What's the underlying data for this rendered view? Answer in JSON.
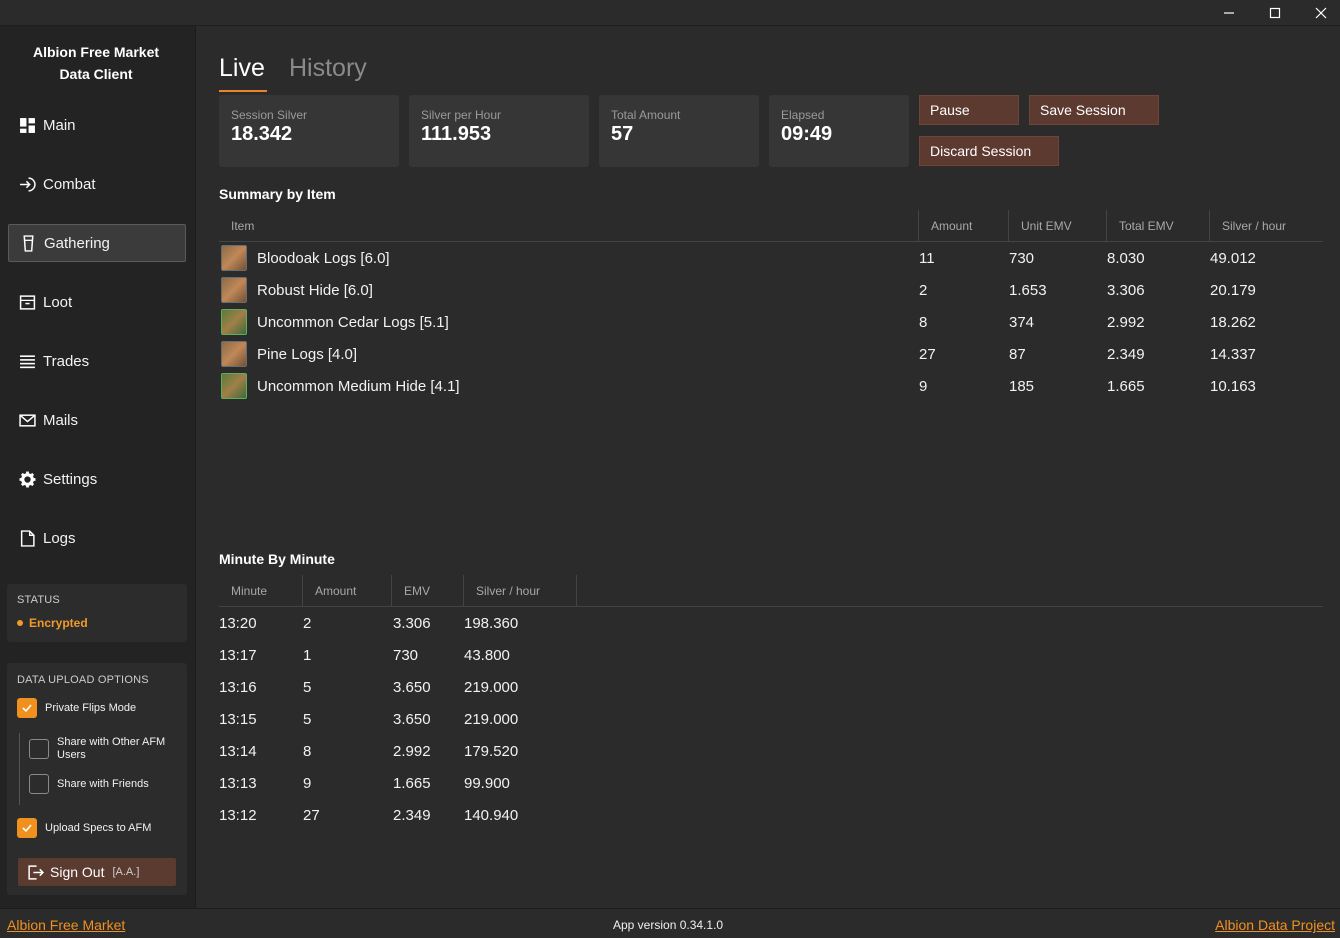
{
  "window": {
    "minimize_icon": "minimize-icon",
    "maximize_icon": "maximize-icon",
    "close_icon": "close-icon"
  },
  "sidebar": {
    "app_title_line1": "Albion Free Market",
    "app_title_line2": "Data Client",
    "items": [
      {
        "label": "Main",
        "icon": "dashboard-icon"
      },
      {
        "label": "Combat",
        "icon": "login-arrow-icon"
      },
      {
        "label": "Gathering",
        "icon": "glass-icon"
      },
      {
        "label": "Loot",
        "icon": "box-icon"
      },
      {
        "label": "Trades",
        "icon": "list-icon"
      },
      {
        "label": "Mails",
        "icon": "mail-icon"
      },
      {
        "label": "Settings",
        "icon": "gear-icon"
      },
      {
        "label": "Logs",
        "icon": "file-icon"
      }
    ],
    "active_index": 2,
    "status": {
      "heading": "STATUS",
      "value": "Encrypted",
      "color": "#f09a2a"
    },
    "upload": {
      "heading": "DATA UPLOAD OPTIONS",
      "private_flips": {
        "label": "Private Flips Mode",
        "checked": true
      },
      "share_other_line1": "Share with Other AFM",
      "share_other_line2": "Users",
      "share_other_checked": false,
      "share_friends": {
        "label": "Share with Friends",
        "checked": false
      },
      "upload_specs": {
        "label": "Upload Specs to AFM",
        "checked": true
      }
    },
    "sign_out": {
      "label": "Sign Out",
      "user": "[A.A.]"
    }
  },
  "tabs": {
    "live": "Live",
    "history": "History"
  },
  "stats": {
    "session_silver": {
      "label": "Session Silver",
      "value": "18.342"
    },
    "silver_per_hour": {
      "label": "Silver per Hour",
      "value": "111.953"
    },
    "total_amount": {
      "label": "Total Amount",
      "value": "57"
    },
    "elapsed": {
      "label": "Elapsed",
      "value": "09:49"
    }
  },
  "actions": {
    "pause": "Pause",
    "save": "Save Session",
    "discard": "Discard Session"
  },
  "summary": {
    "title": "Summary by Item",
    "columns": [
      "Item",
      "Amount",
      "Unit EMV",
      "Total EMV",
      "Silver / hour"
    ],
    "rows": [
      {
        "name": "Bloodoak Logs [6.0]",
        "amount": "11",
        "unit_emv": "730",
        "total_emv": "8.030",
        "silver_hour": "49.012",
        "rarity": "common"
      },
      {
        "name": "Robust Hide [6.0]",
        "amount": "2",
        "unit_emv": "1.653",
        "total_emv": "3.306",
        "silver_hour": "20.179",
        "rarity": "common"
      },
      {
        "name": "Uncommon Cedar Logs [5.1]",
        "amount": "8",
        "unit_emv": "374",
        "total_emv": "2.992",
        "silver_hour": "18.262",
        "rarity": "uncommon"
      },
      {
        "name": "Pine Logs [4.0]",
        "amount": "27",
        "unit_emv": "87",
        "total_emv": "2.349",
        "silver_hour": "14.337",
        "rarity": "common"
      },
      {
        "name": "Uncommon Medium Hide [4.1]",
        "amount": "9",
        "unit_emv": "185",
        "total_emv": "1.665",
        "silver_hour": "10.163",
        "rarity": "uncommon"
      }
    ]
  },
  "minute": {
    "title": "Minute By Minute",
    "columns": [
      "Minute",
      "Amount",
      "EMV",
      "Silver / hour"
    ],
    "rows": [
      {
        "minute": "13:20",
        "amount": "2",
        "emv": "3.306",
        "silver_hour": "198.360"
      },
      {
        "minute": "13:17",
        "amount": "1",
        "emv": "730",
        "silver_hour": "43.800"
      },
      {
        "minute": "13:16",
        "amount": "5",
        "emv": "3.650",
        "silver_hour": "219.000"
      },
      {
        "minute": "13:15",
        "amount": "5",
        "emv": "3.650",
        "silver_hour": "219.000"
      },
      {
        "minute": "13:14",
        "amount": "8",
        "emv": "2.992",
        "silver_hour": "179.520"
      },
      {
        "minute": "13:13",
        "amount": "9",
        "emv": "1.665",
        "silver_hour": "99.900"
      },
      {
        "minute": "13:12",
        "amount": "27",
        "emv": "2.349",
        "silver_hour": "140.940"
      }
    ]
  },
  "footer": {
    "left_link": "Albion Free Market",
    "version": "App version  0.34.1.0",
    "right_link": "Albion Data Project"
  },
  "colors": {
    "accent": "#f0911f",
    "button": "#5d3a30"
  }
}
